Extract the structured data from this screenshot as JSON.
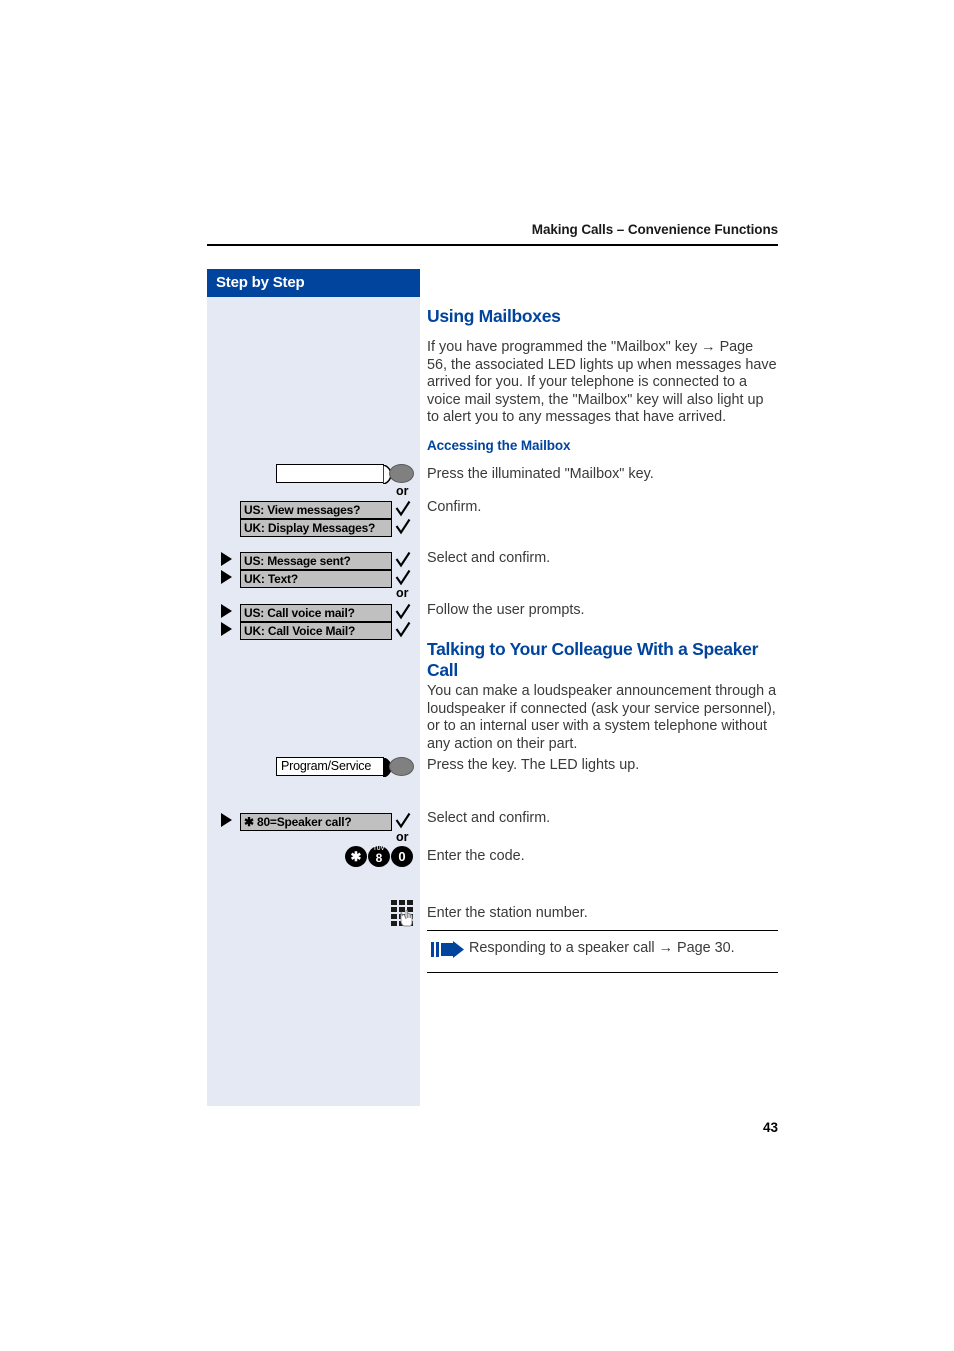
{
  "header": {
    "running_head": "Making Calls – Convenience Functions"
  },
  "sidebar": {
    "title": "Step by Step",
    "or_label_1": "or",
    "or_label_2": "or",
    "or_label_3": "or",
    "mailbox_key_label": "",
    "program_service_key_label": "Program/Service",
    "display_options": [
      {
        "label": "US: View messages?",
        "has_triangle": false
      },
      {
        "label": "UK: Display Messages?",
        "has_triangle": false
      },
      {
        "label": "US: Message sent?",
        "has_triangle": true
      },
      {
        "label": "UK: Text?",
        "has_triangle": true
      },
      {
        "label": "US: Call voice mail?",
        "has_triangle": true
      },
      {
        "label": "UK: Call Voice Mail?",
        "has_triangle": true
      },
      {
        "label": "✱ 80=Speaker call?",
        "has_triangle": true
      }
    ],
    "dial_keys": [
      "✱",
      "8",
      "0"
    ],
    "dial_key_8_letters": "TUV",
    "icons": {
      "led": "led-indicator-icon",
      "checkmark": "checkmark-icon",
      "triangle": "select-triangle-icon",
      "keypad": "keypad-dial-icon",
      "note_arrow": "note-arrow-icon"
    }
  },
  "main": {
    "section1": {
      "title": "Using Mailboxes",
      "intro": "If you have programmed the \"Mailbox\" key → Page 56, the associated LED lights up when messages have arrived for you. If your telephone is connected to a voice mail system, the \"Mailbox\" key will also light up to alert you to any messages that have arrived.",
      "subtitle": "Accessing the Mailbox",
      "steps": [
        "Press the illuminated \"Mailbox\" key.",
        "Confirm.",
        "Select and confirm.",
        "Follow the user prompts."
      ]
    },
    "section2": {
      "title": "Talking to Your Colleague With a Speaker Call",
      "intro": "You can make a loudspeaker announcement through a loudspeaker if connected (ask your service personnel), or to an internal user with a system telephone without any action on their part.",
      "steps": [
        "Press the key. The LED lights up.",
        "Select and confirm.",
        "Enter the code.",
        "Enter the station number."
      ],
      "note": "Responding to a speaker call → Page 30."
    }
  },
  "footer": {
    "page_number": "43"
  },
  "colors": {
    "accent_blue": "#00449e",
    "sidebar_bg": "#e4e9f4",
    "display_box": "#c0c0c0",
    "led_gray": "#808080",
    "body_text": "#3a3a3a"
  }
}
